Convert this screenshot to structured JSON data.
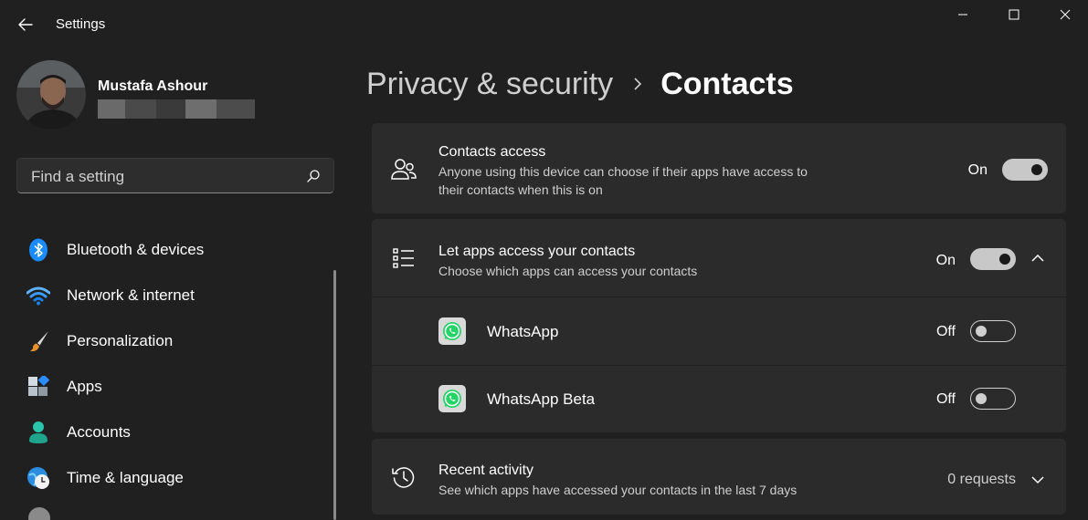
{
  "window": {
    "title": "Settings",
    "controls": [
      "minimize-icon",
      "maximize-icon",
      "close-icon"
    ]
  },
  "profile": {
    "name": "Mustafa Ashour"
  },
  "search": {
    "placeholder": "Find a setting"
  },
  "nav": {
    "items": [
      {
        "label": "Bluetooth & devices",
        "icon": "bluetooth-icon"
      },
      {
        "label": "Network & internet",
        "icon": "wifi-icon"
      },
      {
        "label": "Personalization",
        "icon": "brush-icon"
      },
      {
        "label": "Apps",
        "icon": "apps-icon"
      },
      {
        "label": "Accounts",
        "icon": "person-icon"
      },
      {
        "label": "Time & language",
        "icon": "clock-globe-icon"
      }
    ]
  },
  "breadcrumb": {
    "parent": "Privacy & security",
    "current": "Contacts"
  },
  "contacts_access": {
    "title": "Contacts access",
    "desc_line1": "Anyone using this device can choose if their apps have access to",
    "desc_line2": "their contacts when this is on",
    "state": "On"
  },
  "apps_access": {
    "title": "Let apps access your contacts",
    "desc": "Choose which apps can access your contacts",
    "state": "On",
    "apps": [
      {
        "name": "WhatsApp",
        "state": "Off"
      },
      {
        "name": "WhatsApp Beta",
        "state": "Off"
      }
    ]
  },
  "recent_activity": {
    "title": "Recent activity",
    "desc": "See which apps have accessed your contacts in the last 7 days",
    "value": "0 requests"
  },
  "colors": {
    "background": "#202020",
    "card": "#2b2b2b",
    "toggle_on": "#c8c8c8",
    "whatsapp_green": "#25d366",
    "accent_blue": "#0a84ff"
  }
}
